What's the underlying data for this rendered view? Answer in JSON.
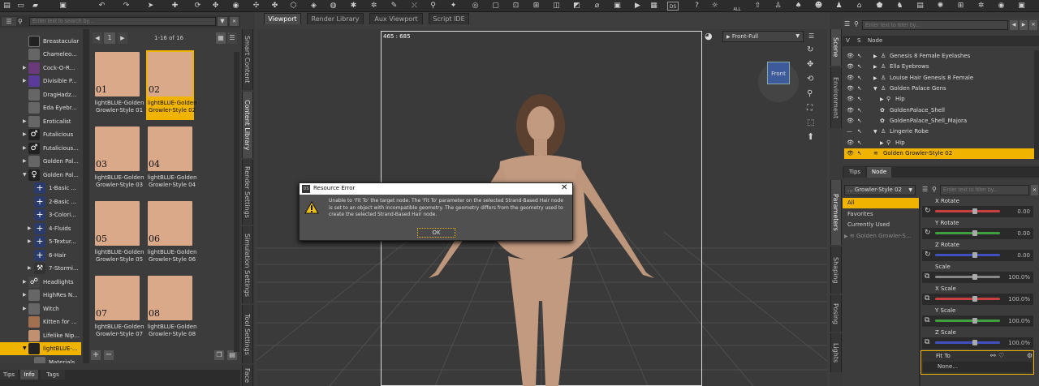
{
  "top_toolbar": {
    "icons": [
      "folder-icon",
      "open-icon",
      "save-icon",
      "undo-icon",
      "redo-icon",
      "pointer-icon",
      "node-select-icon",
      "rotate-icon",
      "translate-icon",
      "scale-icon",
      "universal-icon",
      "joint-editor-icon",
      "geometry-editor-icon",
      "surface-select-icon",
      "region-nav-icon",
      "active-pose-icon",
      "power-pose-icon",
      "spot-render-icon",
      "render-icon",
      "render-settings-icon",
      "iray-icon",
      "ds-icon",
      "all-icon",
      "shape-icon",
      "figure-icon",
      "hair-icon",
      "wardrobe-icon",
      "prop-icon",
      "light-icon",
      "camera-icon"
    ],
    "all_label": "ALL",
    "ds_label": "DS"
  },
  "left_search": {
    "placeholder": "Enter text to search by..."
  },
  "left_tree": {
    "items": [
      {
        "label": "Breastacular"
      },
      {
        "label": "Chameleo..."
      },
      {
        "label": "Cock-O-R..."
      },
      {
        "label": "Divisible P..."
      },
      {
        "label": "DragHadz..."
      },
      {
        "label": "Eda Eyebr..."
      },
      {
        "label": "Eroticalist"
      },
      {
        "label": "Futalicious"
      },
      {
        "label": "Futalicious..."
      },
      {
        "label": "Golden Pal..."
      },
      {
        "label": "Golden Pal..."
      },
      {
        "label": "1-Basic ..."
      },
      {
        "label": "2-Basic ..."
      },
      {
        "label": "3-Colori..."
      },
      {
        "label": "4-Fluids"
      },
      {
        "label": "5-Textur..."
      },
      {
        "label": "6-Hair"
      },
      {
        "label": "7-Stormi..."
      },
      {
        "label": "Headlights"
      },
      {
        "label": "HighRes N..."
      },
      {
        "label": "Witch"
      },
      {
        "label": "Kitten for ..."
      },
      {
        "label": "Lifelike Nip..."
      },
      {
        "label": "lightBLUE-..."
      },
      {
        "label": "Materials"
      }
    ]
  },
  "content_library": {
    "page": "1",
    "range": "1-16 of 16",
    "items": [
      {
        "num": "01",
        "caption": "lightBLUE-Golden Growler-Style 01"
      },
      {
        "num": "02",
        "caption": "lightBLUE-Golden Growler-Style 02"
      },
      {
        "num": "03",
        "caption": "lightBLUE-Golden Growler-Style 03"
      },
      {
        "num": "04",
        "caption": "lightBLUE-Golden Growler-Style 04"
      },
      {
        "num": "05",
        "caption": "lightBLUE-Golden Growler-Style 05"
      },
      {
        "num": "06",
        "caption": "lightBLUE-Golden Growler-Style 06"
      },
      {
        "num": "07",
        "caption": "lightBLUE-Golden Growler-Style 07"
      },
      {
        "num": "08",
        "caption": "lightBLUE-Golden Growler-Style 08"
      }
    ],
    "add_label": "+",
    "remove_label": "−"
  },
  "side_tabs_left": [
    "Smart Content",
    "Content Library",
    "Render Settings",
    "Simulation Settings",
    "Tool Settings",
    "Face"
  ],
  "bottom_tabs": [
    "Tips",
    "Info",
    "Tags"
  ],
  "viewport_tabs": [
    "Viewport",
    "Render Library",
    "Aux Viewport",
    "Script IDE"
  ],
  "viewport": {
    "resolution": "465 : 685",
    "camera": "Front-Full",
    "cube_label": "Front"
  },
  "dialog": {
    "title": "Resource Error",
    "message": "Unable to 'Fit To' the target node. The 'Fit To' parameter on the selected Strand-Based Hair node is set to an object with incompatible geometry. The geometry differs from the geometry used to create the selected Strand-Based Hair node.",
    "ok_label": "OK"
  },
  "scene": {
    "filter_placeholder": "Enter text to filter by...",
    "col_v": "V",
    "col_s": "S",
    "col_node": "Node",
    "rows": [
      {
        "label": "Genesis 8 Female Eyelashes"
      },
      {
        "label": "Ella Eyebrows"
      },
      {
        "label": "Louise Hair Genesis 8 Female"
      },
      {
        "label": "Golden Palace Gens"
      },
      {
        "label": "Hip"
      },
      {
        "label": "GoldenPalace_Shell"
      },
      {
        "label": "GoldenPalace_Shell_Majora"
      },
      {
        "label": "Lingerie Robe"
      },
      {
        "label": "Hip"
      },
      {
        "label": "Golden Growler-Style 02"
      }
    ]
  },
  "right_side_tabs": [
    "Scene",
    "Environment",
    "Parameters",
    "Shaping",
    "Posing",
    "Lights"
  ],
  "tips_node_tabs": [
    "Tips",
    "Node"
  ],
  "parameters": {
    "node_select": "... Growler-Style 02",
    "filter_placeholder": "Enter text to filter by...",
    "groups": [
      "All",
      "Favorites",
      "Currently Used"
    ],
    "tree_item": "Golden Growler-S...",
    "items": [
      {
        "name": "X Rotate",
        "value": "0.00",
        "color": "#c84040"
      },
      {
        "name": "Y Rotate",
        "value": "0.00",
        "color": "#40a040"
      },
      {
        "name": "Z Rotate",
        "value": "0.00",
        "color": "#4050c0"
      },
      {
        "name": "Scale",
        "value": "100.0%",
        "color": "#888888"
      },
      {
        "name": "X Scale",
        "value": "100.0%",
        "color": "#c84040"
      },
      {
        "name": "Y Scale",
        "value": "100.0%",
        "color": "#40a040"
      },
      {
        "name": "Z Scale",
        "value": "100.0%",
        "color": "#4050c0"
      }
    ],
    "fit_to_label": "Fit To",
    "fit_to_value": "None..."
  }
}
